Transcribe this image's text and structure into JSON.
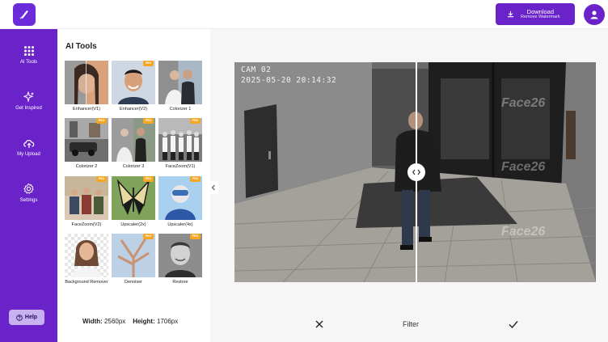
{
  "header": {
    "download_label": "Download",
    "download_sublabel": "Remove Watermark"
  },
  "nav": {
    "items": [
      {
        "label": "AI Tools",
        "icon": "grid-icon"
      },
      {
        "label": "Get Inspired",
        "icon": "sparkle-icon"
      },
      {
        "label": "My Upload",
        "icon": "cloud-upload-icon"
      },
      {
        "label": "Settings",
        "icon": "gear-icon"
      }
    ],
    "help_label": "Help"
  },
  "tools": {
    "title": "AI Tools",
    "pro_badge": "PRO",
    "items": [
      {
        "name": "Enhancer(V1)",
        "pro": false
      },
      {
        "name": "Enhancer(V2)",
        "pro": true
      },
      {
        "name": "Colorizer 1",
        "pro": false
      },
      {
        "name": "Colorizer 2",
        "pro": true
      },
      {
        "name": "Colorizer 3",
        "pro": true
      },
      {
        "name": "FaceZoom(V1)",
        "pro": false
      },
      {
        "name": "FaceZoom(V2)",
        "pro": true
      },
      {
        "name": "Upscaler(2x)",
        "pro": true
      },
      {
        "name": "Upscaler(4x)",
        "pro": true
      },
      {
        "name": "Background Remover",
        "pro": false
      },
      {
        "name": "Denoiser",
        "pro": true
      },
      {
        "name": "Restore",
        "pro": true
      }
    ],
    "width_label": "Width:",
    "width_value": "2560px",
    "height_label": "Height:",
    "height_value": "1706px"
  },
  "preview": {
    "cam_label": "CAM 02",
    "timestamp": "2025-05-20 20:14:32",
    "watermark": "Face26"
  },
  "footer": {
    "filter_label": "Filter"
  },
  "colors": {
    "brand": "#6a23c8",
    "pro": "#f5a623"
  }
}
